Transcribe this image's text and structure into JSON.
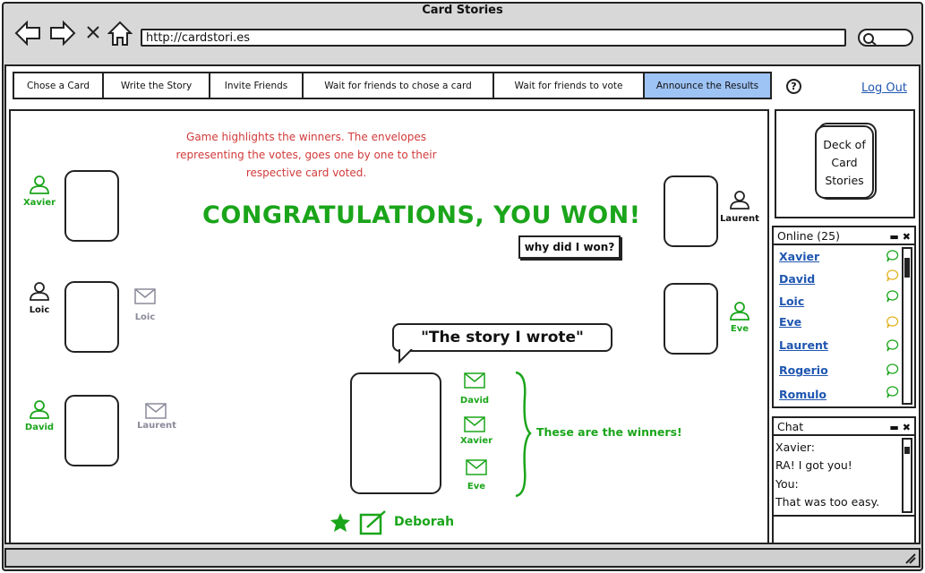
{
  "browser": {
    "title": "Card Stories",
    "url": "http://cardstori.es",
    "icons": [
      "back-arrow-icon",
      "forward-arrow-icon",
      "close-icon",
      "home-icon",
      "search-icon"
    ]
  },
  "tabs": [
    {
      "label": "Chose a Card",
      "active": false
    },
    {
      "label": "Write the Story",
      "active": false
    },
    {
      "label": "Invite Friends",
      "active": false
    },
    {
      "label": "Wait for friends to chose a card",
      "active": false
    },
    {
      "label": "Wait for friends to vote",
      "active": false
    },
    {
      "label": "Announce the Results",
      "active": true
    }
  ],
  "header": {
    "help": "?",
    "logout": "Log Out"
  },
  "board": {
    "note": "Game highlights the winners. The envelopes representing the votes, goes one by one to their respective card voted.",
    "congrats": "CONGRATULATIONS, YOU WON!",
    "why_button": "why did I won?",
    "story": "\"The story I wrote\"",
    "winners_label": "These are the winners!",
    "author": "Deborah",
    "players": [
      {
        "name": "Xavier"
      },
      {
        "name": "Loic"
      },
      {
        "name": "David"
      },
      {
        "name": "Laurent"
      },
      {
        "name": "Eve"
      }
    ],
    "votes_loose": [
      {
        "name": "Loic"
      },
      {
        "name": "Laurent"
      }
    ],
    "votes_on_story": [
      {
        "name": "David"
      },
      {
        "name": "Xavier"
      },
      {
        "name": "Eve"
      }
    ]
  },
  "deck": {
    "label": "Deck of Card Stories"
  },
  "online": {
    "title": "Online (25)",
    "users": [
      {
        "name": "Xavier",
        "status": "green"
      },
      {
        "name": "David",
        "status": "yellow"
      },
      {
        "name": "Loic",
        "status": "green"
      },
      {
        "name": "Eve",
        "status": "yellow"
      },
      {
        "name": "Laurent",
        "status": "green"
      },
      {
        "name": "Rogerio",
        "status": "green"
      },
      {
        "name": "Romulo",
        "status": "green"
      }
    ]
  },
  "chat": {
    "title": "Chat",
    "lines": [
      "Xavier:",
      "RA! I got you!",
      "You:",
      "That was too easy."
    ]
  },
  "colors": {
    "accent_green": "#1aa51a",
    "note_red": "#d23a3a",
    "tab_active": "#9ec3f5",
    "link": "#1f56b0"
  }
}
